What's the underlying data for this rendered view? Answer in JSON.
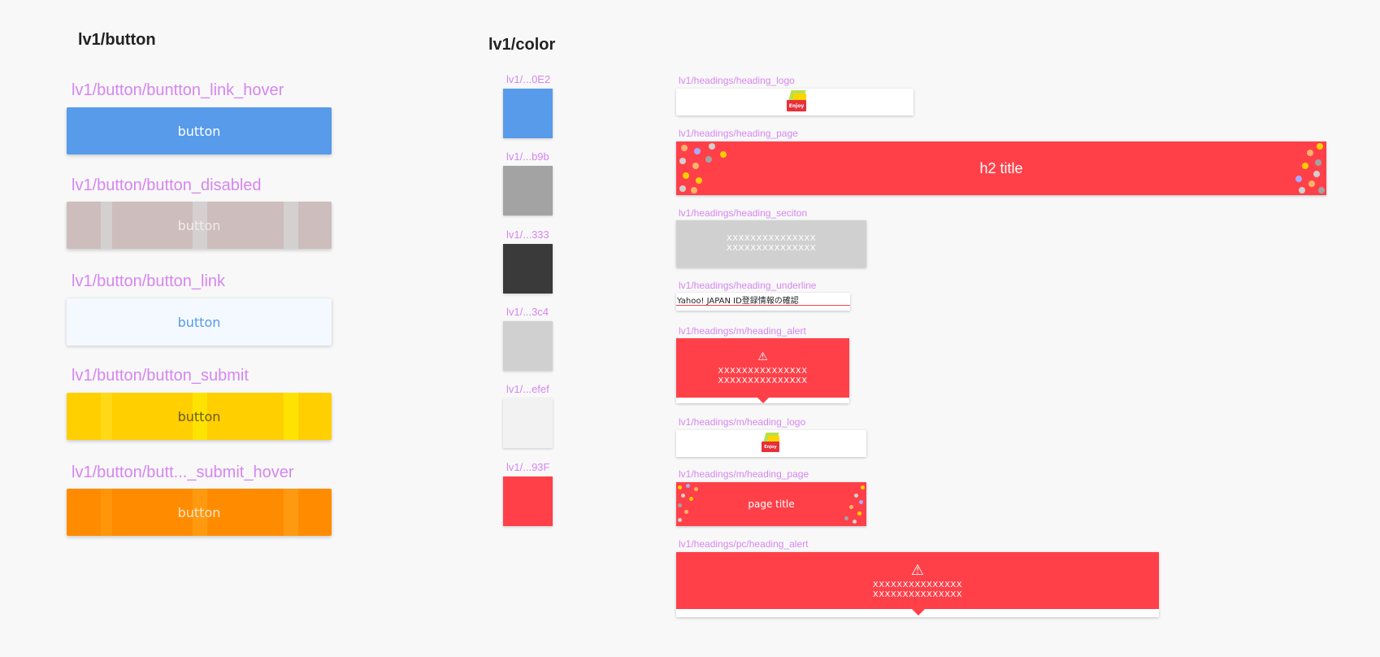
{
  "sections": {
    "button_title": "lv1/button",
    "color_title": "lv1/color"
  },
  "buttons": [
    {
      "label": "lv1/button/buntton_link_hover",
      "text": "button",
      "bg": "#579bea",
      "fg": "#ffffff"
    },
    {
      "label": "lv1/button/button_disabled",
      "text": "button",
      "bg": "#cdbdbd",
      "fg": "#f4eaea"
    },
    {
      "label": "lv1/button/button_link",
      "text": "button",
      "bg": "#f3f9fe",
      "fg": "#579bea"
    },
    {
      "label": "lv1/button/button_submit",
      "text": "button",
      "bg": "#ffcf00",
      "fg": "#6b5a1e"
    },
    {
      "label": "lv1/button/butt..._submit_hover",
      "text": "button",
      "bg": "#ff8c00",
      "fg": "#ffe6c6"
    }
  ],
  "colors": [
    {
      "label": "lv1/...0E2",
      "hex": "#579bea"
    },
    {
      "label": "lv1/...b9b",
      "hex": "#a3a3a3"
    },
    {
      "label": "lv1/...333",
      "hex": "#3a3a3a"
    },
    {
      "label": "lv1/...3c4",
      "hex": "#d0d0d0"
    },
    {
      "label": "lv1/...efef",
      "hex": "#f2f2f2"
    },
    {
      "label": "lv1/...93F",
      "hex": "#ff4049"
    }
  ],
  "headings": {
    "heading_logo": {
      "label": "lv1/headings/heading_logo",
      "logo_text": "Enjoy"
    },
    "heading_page": {
      "label": "lv1/headings/heading_page",
      "title": "h2 title"
    },
    "heading_section": {
      "label": "lv1/headings/heading_seciton",
      "line1": "XXXXXXXXXXXXXXX",
      "line2": "XXXXXXXXXXXXXXX"
    },
    "heading_underline": {
      "label": "lv1/headings/heading_underline",
      "text": "Yahoo! JAPAN ID登録情報の確認"
    },
    "m_heading_alert": {
      "label": "lv1/headings/m/heading_alert",
      "icon": "warning-icon",
      "line1": "XXXXXXXXXXXXXXX",
      "line2": "XXXXXXXXXXXXXXX"
    },
    "m_heading_logo": {
      "label": "lv1/headings/m/heading_logo",
      "logo_text": "Enjoy"
    },
    "m_heading_page": {
      "label": "lv1/headings/m/heading_page",
      "title": "page title"
    },
    "pc_heading_alert": {
      "label": "lv1/headings/pc/heading_alert",
      "icon": "warning-icon",
      "line1": "XXXXXXXXXXXXXXX",
      "line2": "XXXXXXXXXXXXXXX"
    }
  }
}
